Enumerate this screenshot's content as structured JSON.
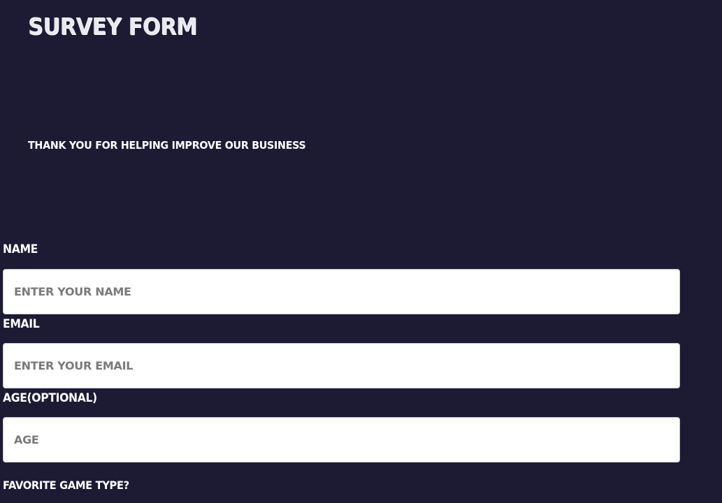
{
  "header": {
    "title": "SURVEY FORM",
    "description": "THANK YOU FOR HELPING IMPROVE OUR BUSINESS"
  },
  "form": {
    "name": {
      "label": "NAME",
      "placeholder": "ENTER YOUR NAME"
    },
    "email": {
      "label": "EMAIL",
      "placeholder": "ENTER YOUR EMAIL"
    },
    "age": {
      "label": "AGE(OPTIONAL)",
      "placeholder": "AGE"
    },
    "game_type": {
      "label": "FAVORITE GAME TYPE?"
    }
  },
  "colors": {
    "background": "#1c1b33",
    "input_background": "#ffffff",
    "text": "#ffffff",
    "placeholder": "#7a7a7a"
  }
}
